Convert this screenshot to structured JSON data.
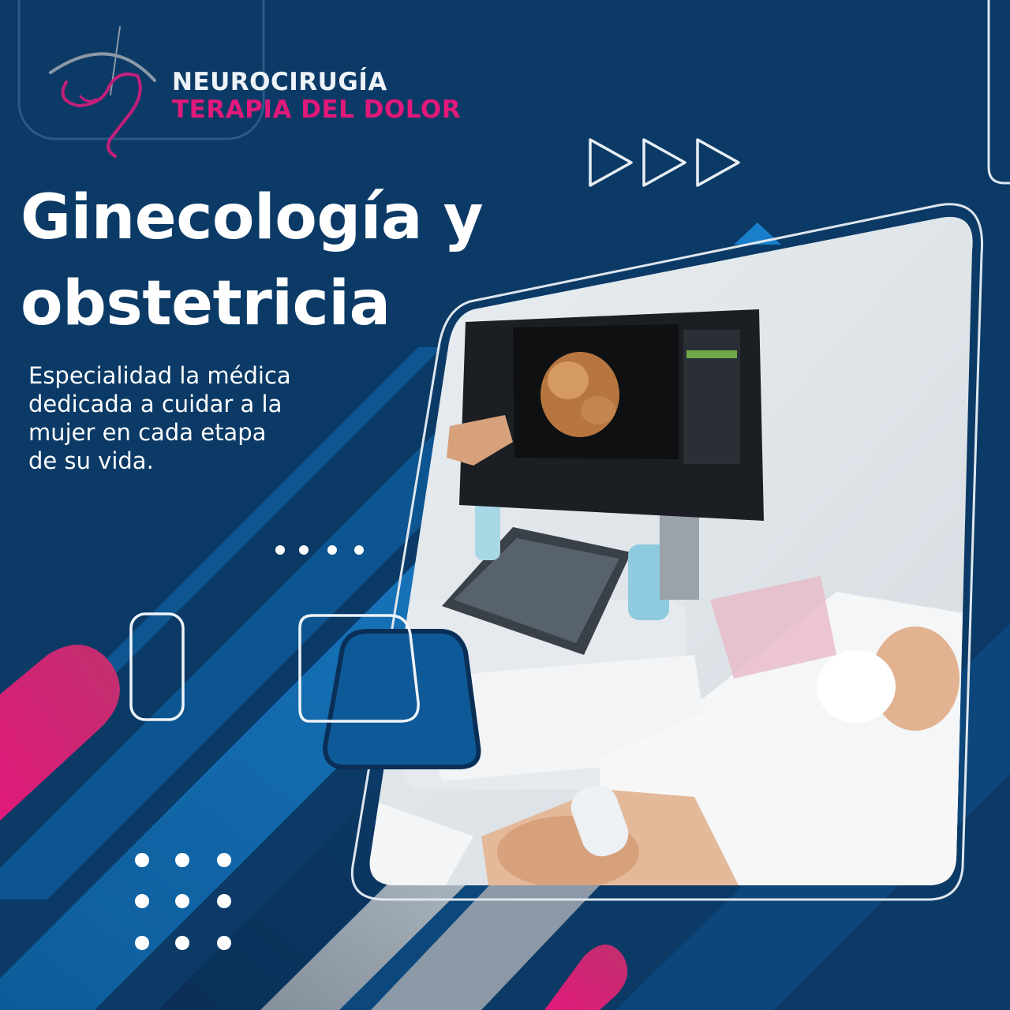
{
  "brand": {
    "line1": "NEUROCIRUGÍA",
    "line2": "TERAPIA DEL DOLOR",
    "logo_icon": "head-profile-logo-icon"
  },
  "headline": {
    "line1": "Ginecología y",
    "line2": "obstetricia"
  },
  "subtitle": {
    "lines": [
      "Especialidad la médica",
      "dedicada a cuidar a la",
      "mujer en cada etapa",
      "de su vida."
    ]
  },
  "photo": {
    "subject": "ultrasound-examination-photo"
  },
  "colors": {
    "background": "#0b3a66",
    "accent_pink": "#e0197a",
    "accent_blue": "#1478c8",
    "outline": "#dfe6ee"
  }
}
